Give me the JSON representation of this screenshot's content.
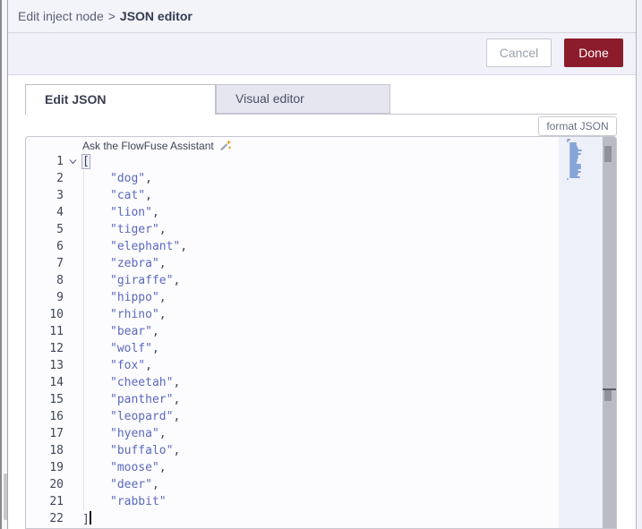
{
  "breadcrumb": {
    "parent": "Edit inject node",
    "separator": ">",
    "current": "JSON editor"
  },
  "buttons": {
    "cancel": "Cancel",
    "done": "Done"
  },
  "tabs": {
    "edit_json": "Edit JSON",
    "visual_editor": "Visual editor"
  },
  "toolbar": {
    "format_json": "format JSON"
  },
  "editor": {
    "assistant_hint": "Ask the FlowFuse Assistant",
    "language": "json",
    "lines": [
      {
        "num": 1,
        "bracket": "[",
        "fold": true,
        "highlight": true
      },
      {
        "num": 2,
        "string": "dog",
        "comma": true
      },
      {
        "num": 3,
        "string": "cat",
        "comma": true
      },
      {
        "num": 4,
        "string": "lion",
        "comma": true
      },
      {
        "num": 5,
        "string": "tiger",
        "comma": true
      },
      {
        "num": 6,
        "string": "elephant",
        "comma": true
      },
      {
        "num": 7,
        "string": "zebra",
        "comma": true
      },
      {
        "num": 8,
        "string": "giraffe",
        "comma": true
      },
      {
        "num": 9,
        "string": "hippo",
        "comma": true
      },
      {
        "num": 10,
        "string": "rhino",
        "comma": true
      },
      {
        "num": 11,
        "string": "bear",
        "comma": true
      },
      {
        "num": 12,
        "string": "wolf",
        "comma": true
      },
      {
        "num": 13,
        "string": "fox",
        "comma": true
      },
      {
        "num": 14,
        "string": "cheetah",
        "comma": true
      },
      {
        "num": 15,
        "string": "panther",
        "comma": true
      },
      {
        "num": 16,
        "string": "leopard",
        "comma": true
      },
      {
        "num": 17,
        "string": "hyena",
        "comma": true
      },
      {
        "num": 18,
        "string": "buffalo",
        "comma": true
      },
      {
        "num": 19,
        "string": "moose",
        "comma": true
      },
      {
        "num": 20,
        "string": "deer",
        "comma": true
      },
      {
        "num": 21,
        "string": "rabbit",
        "comma": false
      },
      {
        "num": 22,
        "bracket": "]",
        "cursor": true
      }
    ]
  },
  "colors": {
    "done_button": "#8C1C2B",
    "string_token": "#5B68BD",
    "punctuation": "#3B415C",
    "tab_inactive_bg": "#E6E6F0",
    "minimap_mark": "#86A4D6",
    "tray_header_bg": "#F3F3FA"
  }
}
